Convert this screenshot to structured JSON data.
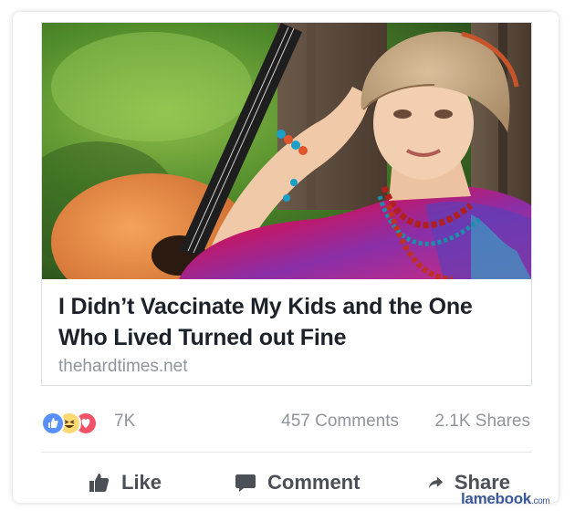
{
  "post": {
    "headline": "I Didn’t Vaccinate My Kids and the One Who Lived Turned out Fine",
    "domain": "thehardtimes.net"
  },
  "stats": {
    "reactions": [
      "like-icon",
      "haha-icon",
      "love-icon"
    ],
    "reaction_count": "7K",
    "comments": "457 Comments",
    "shares": "2.1K Shares"
  },
  "actions": {
    "like": "Like",
    "comment": "Comment",
    "share": "Share"
  },
  "watermark": {
    "main": "lamebook",
    "suffix": ".com"
  },
  "colors": {
    "brand": "#3b5998",
    "like_blue": "#5890ff",
    "love_red": "#f25268",
    "haha_yellow": "#ffd972",
    "text_dark": "#1d2129",
    "text_muted": "#90949c"
  }
}
